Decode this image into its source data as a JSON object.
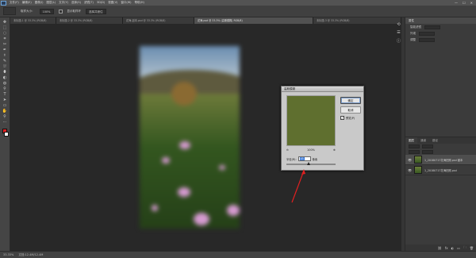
{
  "colors": {
    "accent_red": "#e02020",
    "selection_blue": "#3a78d6",
    "preview_green": "#5f6f2f"
  },
  "menubar": {
    "items": [
      "文件(F)",
      "编辑(E)",
      "图像(I)",
      "图层(L)",
      "文字(Y)",
      "选择(S)",
      "滤镜(T)",
      "3D(D)",
      "视图(V)",
      "窗口(W)",
      "帮助(H)"
    ],
    "controls": [
      "—",
      "☐",
      "✕"
    ]
  },
  "options": {
    "preset_icon": "eyedropper-icon",
    "sample_size_value": "取样大小：",
    "mode_value": "100%",
    "check_label": "显示取样环",
    "refine_label": "选择并遮住"
  },
  "tabs": [
    {
      "label": "未标题-1 @ 33.3% (RGB/8)"
    },
    {
      "label": "未标题-2 @ 33.3% (RGB/8)"
    },
    {
      "label": "花海-副本.psd @ 33.3% (RGB/8)"
    },
    {
      "label": "花海.psd @ 33.3% (高斯模糊, RGB/8)"
    },
    {
      "label": "未标题-3 @ 33.3% (RGB/8)"
    }
  ],
  "tools": [
    "✥",
    "⬚",
    "◌",
    "⌗",
    "✂",
    "✒",
    "⚕",
    "✎",
    "⛆",
    "⬮",
    "◐",
    "◍",
    "⚲",
    "T",
    "➤",
    "▭",
    "✋",
    "⚲",
    "⋯"
  ],
  "dialog": {
    "title": "高斯模糊",
    "ok_label": "确定",
    "cancel_label": "取消",
    "preview_label": "预览(P)",
    "preview_checked": "✓",
    "zoom_out": "⊖",
    "zoom_level": "100%",
    "zoom_in": "⊕",
    "radius_label": "半径(R):",
    "radius_value": "45",
    "radius_unit": "像素",
    "radius_slider_fraction": 0.45
  },
  "right_panel": {
    "tab_label": "属性",
    "rows": [
      "智能滤镜",
      "外观",
      "调整"
    ]
  },
  "layers": {
    "tabs": [
      "图层",
      "通道",
      "路径"
    ],
    "rows": [
      {
        "name": "1_20180717花海拍照.psd 副本",
        "eye": "👁",
        "selected": true
      },
      {
        "name": "1_20180717花海拍照.psd",
        "eye": "👁",
        "selected": false
      }
    ],
    "bottom_icons": [
      "⛓",
      "fx",
      "◐",
      "▭",
      "🗀",
      "🗑"
    ]
  },
  "statusbar": {
    "zoom": "33.33%",
    "doc_info": "文档:12.4M/12.4M"
  }
}
